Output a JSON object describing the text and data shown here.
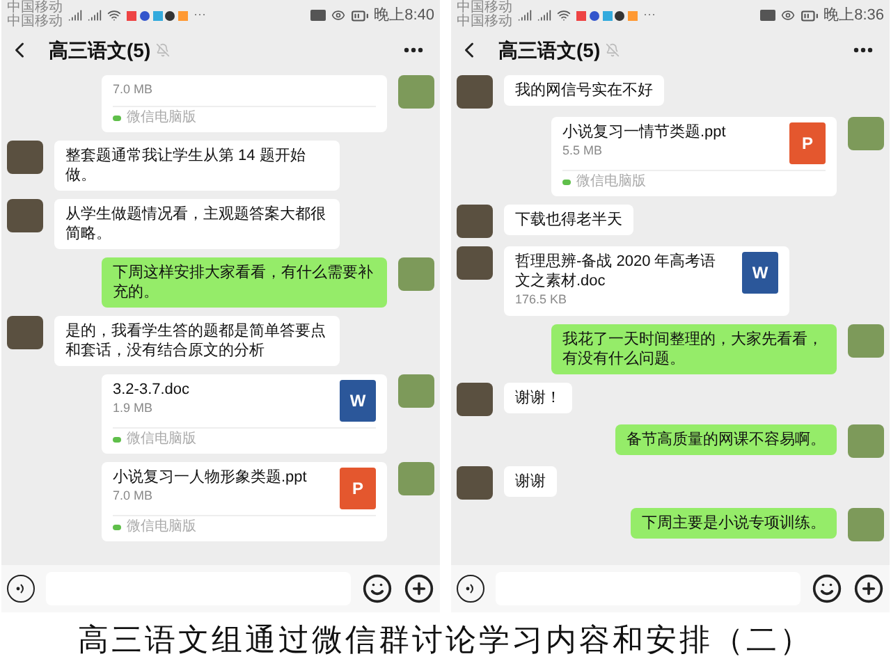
{
  "phones": [
    {
      "status": {
        "carriers": [
          "中国移动",
          "中国移动"
        ],
        "more": "···",
        "time": "晚上8:40"
      },
      "title": "高三语文(5)",
      "messages": [
        {
          "kind": "file",
          "outgoing": true,
          "size": "7.0 MB",
          "source": "微信电脑版"
        },
        {
          "kind": "text",
          "outgoing": false,
          "text": "整套题通常我让学生从第 14 题开始做。"
        },
        {
          "kind": "text",
          "outgoing": false,
          "text": "从学生做题情况看，主观题答案大都很简略。"
        },
        {
          "kind": "text",
          "outgoing": true,
          "text": "下周这样安排大家看看，有什么需要补充的。"
        },
        {
          "kind": "text",
          "outgoing": false,
          "text": "是的，我看学生答的题都是简单答要点和套话，没有结合原文的分析"
        },
        {
          "kind": "file",
          "outgoing": true,
          "name": "3.2-3.7.doc",
          "size": "1.9 MB",
          "icon": {
            "kind": "doc",
            "letter": "W"
          },
          "source": "微信电脑版"
        },
        {
          "kind": "file",
          "outgoing": true,
          "name": "小说复习一人物形象类题.ppt",
          "size": "7.0 MB",
          "icon": {
            "kind": "ppt",
            "letter": "P"
          },
          "source": "微信电脑版"
        }
      ]
    },
    {
      "status": {
        "carriers": [
          "中国移动",
          "中国移动"
        ],
        "more": "···",
        "time": "晚上8:36"
      },
      "title": "高三语文(5)",
      "messages": [
        {
          "kind": "text",
          "outgoing": false,
          "text": "我的网信号实在不好"
        },
        {
          "kind": "file",
          "outgoing": true,
          "name": "小说复习一情节类题.ppt",
          "size": "5.5 MB",
          "icon": {
            "kind": "ppt",
            "letter": "P"
          },
          "source": "微信电脑版"
        },
        {
          "kind": "text",
          "outgoing": false,
          "text": "下载也得老半天"
        },
        {
          "kind": "file",
          "outgoing": false,
          "name": "哲理思辨-备战 2020 年高考语文之素材.doc",
          "size": "176.5 KB",
          "icon": {
            "kind": "doc",
            "letter": "W"
          }
        },
        {
          "kind": "text",
          "outgoing": true,
          "text": "我花了一天时间整理的，大家先看看，有没有什么问题。"
        },
        {
          "kind": "text",
          "outgoing": false,
          "text": "谢谢！"
        },
        {
          "kind": "text",
          "outgoing": true,
          "text": "备节高质量的网课不容易啊。"
        },
        {
          "kind": "text",
          "outgoing": false,
          "text": "谢谢"
        },
        {
          "kind": "text",
          "outgoing": true,
          "text": "下周主要是小说专项训练。"
        }
      ]
    }
  ],
  "caption": "高三语文组通过微信群讨论学习内容和安排（二）"
}
